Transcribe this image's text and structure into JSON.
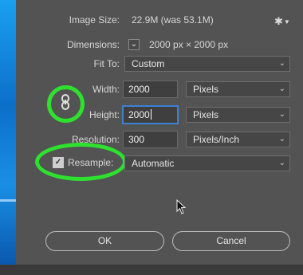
{
  "image_size": {
    "label": "Image Size:",
    "value": "22.9M (was 53.1M)"
  },
  "dimensions": {
    "label": "Dimensions:",
    "value": "2000 px  ×  2000 px"
  },
  "fit_to": {
    "label": "Fit To:",
    "value": "Custom"
  },
  "width": {
    "label": "Width:",
    "value": "2000",
    "unit": "Pixels"
  },
  "height": {
    "label": "Height:",
    "value": "2000",
    "unit": "Pixels"
  },
  "resolution": {
    "label": "Resolution:",
    "value": "300",
    "unit": "Pixels/Inch"
  },
  "resample": {
    "label": "Resample:",
    "checked": true,
    "value": "Automatic"
  },
  "buttons": {
    "ok": "OK",
    "cancel": "Cancel"
  },
  "icons": {
    "settings": "gear-icon",
    "constrain": "link-icon",
    "checkbox": "check-icon"
  },
  "colors": {
    "highlight_ring": "#2fe12f",
    "focus": "#3b82d6",
    "background": "#535353"
  }
}
